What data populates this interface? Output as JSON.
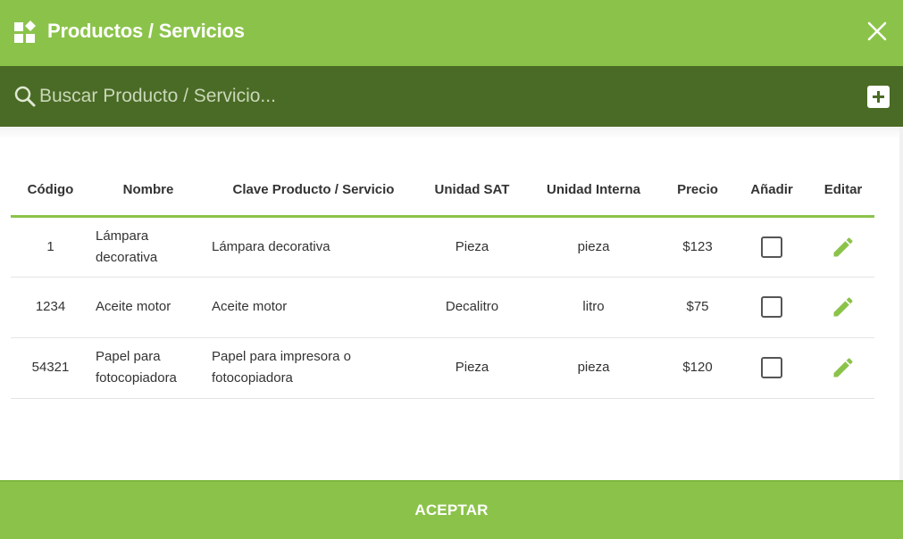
{
  "header": {
    "title": "Productos / Servicios",
    "icon": "widgets-icon",
    "close_icon": "close-icon"
  },
  "search": {
    "placeholder": "Buscar Producto / Servicio...",
    "value": "",
    "add_icon": "add-box-icon"
  },
  "table": {
    "columns": [
      "Código",
      "Nombre",
      "Clave Producto / Servicio",
      "Unidad SAT",
      "Unidad Interna",
      "Precio",
      "Añadir",
      "Editar"
    ],
    "rows": [
      {
        "codigo": "1",
        "nombre": "Lámpara decorativa",
        "clave": "Lámpara decorativa",
        "unidad_sat": "Pieza",
        "unidad_interna": "pieza",
        "precio": "$123",
        "anadir": false
      },
      {
        "codigo": "1234",
        "nombre": "Aceite motor",
        "clave": "Aceite motor",
        "unidad_sat": "Decalitro",
        "unidad_interna": "litro",
        "precio": "$75",
        "anadir": false
      },
      {
        "codigo": "54321",
        "nombre": "Papel para fotocopiadora",
        "clave": "Papel para impresora o fotocopiadora",
        "unidad_sat": "Pieza",
        "unidad_interna": "pieza",
        "precio": "$120",
        "anadir": false
      }
    ]
  },
  "footer": {
    "accept_label": "ACEPTAR"
  },
  "colors": {
    "primary": "#8bc34a",
    "dark": "#4a6b25",
    "text": "#333333"
  }
}
